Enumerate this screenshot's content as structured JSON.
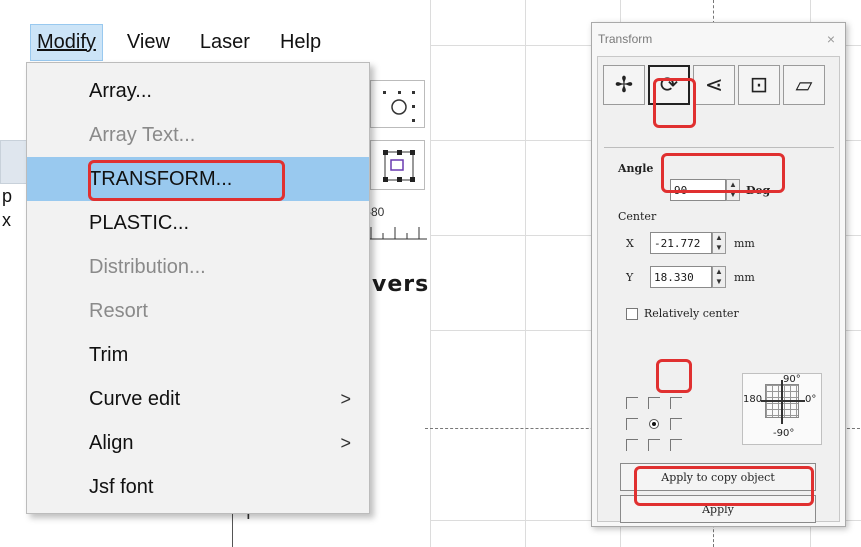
{
  "menubar": {
    "items": [
      {
        "label": "Modify",
        "active": true
      },
      {
        "label": "View",
        "active": false
      },
      {
        "label": "Laser",
        "active": false
      },
      {
        "label": "Help",
        "active": false
      }
    ]
  },
  "dropdown": {
    "items": [
      {
        "label": "Array...",
        "disabled": false,
        "submenu": false
      },
      {
        "label": "Array Text...",
        "disabled": true,
        "submenu": false
      },
      {
        "label": "TRANSFORM...",
        "disabled": false,
        "submenu": false,
        "highlighted": true
      },
      {
        "label": "PLASTIC...",
        "disabled": false,
        "submenu": false
      },
      {
        "label": "Distribution...",
        "disabled": true,
        "submenu": false
      },
      {
        "label": "Resort",
        "disabled": true,
        "submenu": false
      },
      {
        "label": "Trim",
        "disabled": false,
        "submenu": false
      },
      {
        "label": "Curve edit",
        "disabled": false,
        "submenu": true
      },
      {
        "label": "Align",
        "disabled": false,
        "submenu": true
      },
      {
        "label": "Jsf font",
        "disabled": false,
        "submenu": false
      }
    ],
    "submenu_arrow": ">"
  },
  "background": {
    "ruler_value": "-80",
    "vers_text": "vers",
    "left_p": "p",
    "left_x": "x"
  },
  "transform": {
    "title": "Transform",
    "close": "×",
    "tools": [
      {
        "icon": "move-icon",
        "glyph": "✢",
        "selected": false
      },
      {
        "icon": "rotate-icon",
        "glyph": "⟳",
        "selected": true
      },
      {
        "icon": "mirror-icon",
        "glyph": "⋖",
        "selected": false
      },
      {
        "icon": "scale-icon",
        "glyph": "⊡",
        "selected": false
      },
      {
        "icon": "skew-icon",
        "glyph": "▱",
        "selected": false
      }
    ],
    "angle_label": "Angle",
    "angle_value": "90",
    "angle_unit": "Deg",
    "center_label": "Center",
    "x_label": "X",
    "x_value": "-21.772",
    "x_unit": "mm",
    "y_label": "Y",
    "y_value": "18.330",
    "y_unit": "mm",
    "relative_label": "Relatively center",
    "relative_checked": false,
    "dial_labels": {
      "top": "90°",
      "left": "180",
      "right": "0°",
      "bottom": "-90°"
    },
    "apply_copy_label": "Apply to copy object",
    "apply_label": "Apply"
  },
  "colors": {
    "highlight": "#99c9ef",
    "annotation_red": "#e03030"
  }
}
